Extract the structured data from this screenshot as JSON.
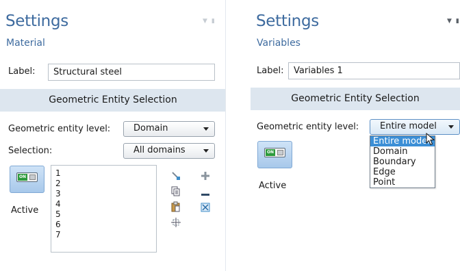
{
  "panel_left": {
    "title": "Settings",
    "subtitle": "Material",
    "label_caption": "Label:",
    "label_value": "Structural steel",
    "section_title": "Geometric Entity Selection",
    "entity_level_caption": "Geometric entity level:",
    "entity_level_value": "Domain",
    "selection_caption": "Selection:",
    "selection_value": "All domains",
    "active_label": "Active",
    "toggle_text": "ON",
    "selection_items": [
      "1",
      "2",
      "3",
      "4",
      "5",
      "6",
      "7"
    ],
    "side_icons": [
      "paste-selection-icon",
      "copy-icon",
      "clipboard-icon",
      "zoom-to-selection-icon",
      "add-icon",
      "remove-icon",
      "clear-selection-icon"
    ]
  },
  "panel_right": {
    "title": "Settings",
    "subtitle": "Variables",
    "label_caption": "Label:",
    "label_value": "Variables 1",
    "section_title": "Geometric Entity Selection",
    "entity_level_caption": "Geometric entity level:",
    "entity_level_value": "Entire model",
    "active_label": "Active",
    "toggle_text": "ON",
    "dropdown_options": [
      "Entire model",
      "Domain",
      "Boundary",
      "Edge",
      "Point"
    ],
    "dropdown_selected": "Entire model"
  },
  "colors": {
    "title": "#3e6b9f",
    "section_bar": "#dde6ef",
    "dropdown_highlight": "#3c8fd6"
  }
}
